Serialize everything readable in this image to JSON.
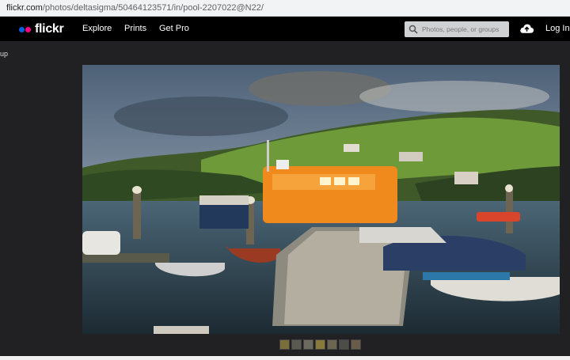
{
  "browser": {
    "url_host": "flickr.com",
    "url_path": "/photos/deltasigma/50464123571/in/pool-2207022@N22/"
  },
  "header": {
    "logo_text": "flickr",
    "nav": [
      "Explore",
      "Prints",
      "Get Pro"
    ],
    "search_placeholder": "Photos, people, or groups",
    "login_label": "Log In",
    "upload_icon": "cloud-upload-icon",
    "search_icon": "search-icon",
    "brand_colors": {
      "blue": "#0063dc",
      "pink": "#ff0084"
    }
  },
  "side": {
    "partial_label": "up"
  },
  "photo": {
    "alt": "Harbour pontoon with orange lifeboat and small boats"
  },
  "filmstrip": {
    "colors": [
      "#7a6f3c",
      "#5b5a50",
      "#6c6a5e",
      "#8a7a3a",
      "#6d6550",
      "#4c4c48",
      "#6a5c4a"
    ]
  }
}
